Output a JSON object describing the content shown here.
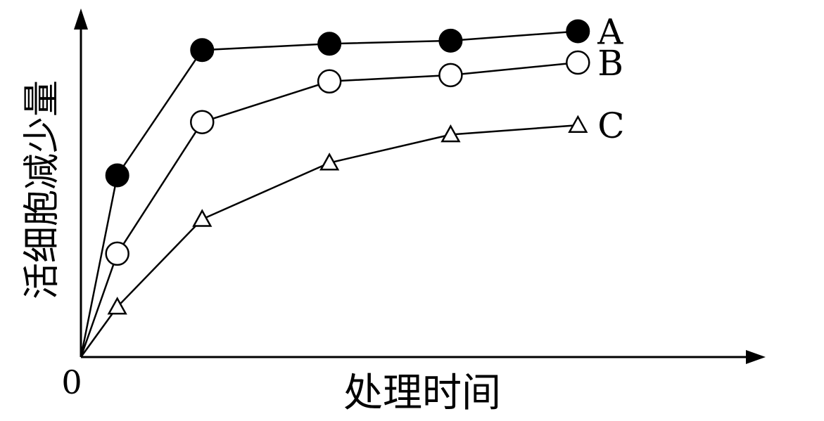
{
  "chart_data": {
    "type": "line",
    "title": "",
    "xlabel": "处理时间",
    "ylabel": "活细胞减少量",
    "origin_label": "0",
    "x": [
      0,
      1,
      2,
      3,
      4,
      5
    ],
    "xlim": [
      0,
      5.3
    ],
    "ylim": [
      0,
      1.05
    ],
    "grid": false,
    "legend": "series labels at right end of lines",
    "series": [
      {
        "name": "A",
        "marker": "filled-circle",
        "x": [
          0,
          0.3,
          1.0,
          2.05,
          3.05,
          4.1
        ],
        "values": [
          0,
          0.58,
          0.98,
          1.0,
          1.01,
          1.04
        ]
      },
      {
        "name": "B",
        "marker": "open-circle",
        "x": [
          0,
          0.3,
          1.0,
          2.05,
          3.05,
          4.1
        ],
        "values": [
          0,
          0.33,
          0.75,
          0.88,
          0.9,
          0.94
        ]
      },
      {
        "name": "C",
        "marker": "open-triangle",
        "x": [
          0,
          0.3,
          1.0,
          2.05,
          3.05,
          4.1
        ],
        "values": [
          0,
          0.16,
          0.44,
          0.62,
          0.71,
          0.74
        ]
      }
    ]
  }
}
